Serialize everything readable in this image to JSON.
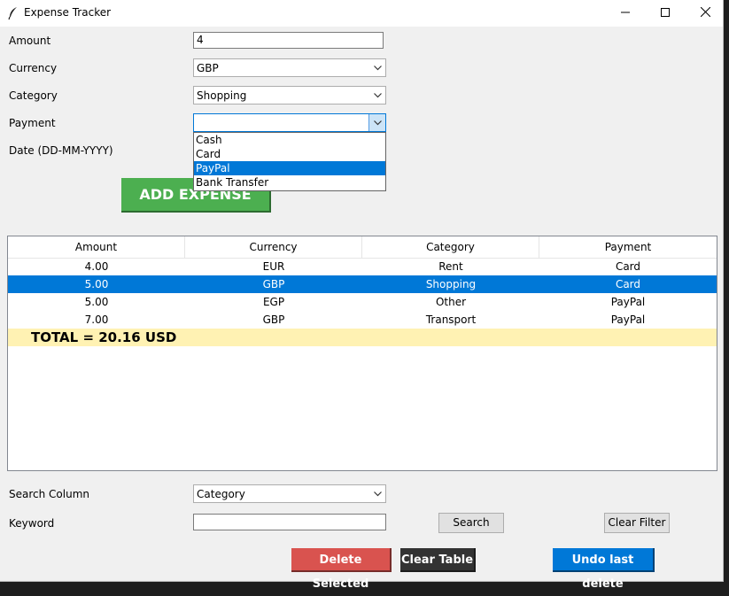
{
  "window": {
    "title": "Expense Tracker"
  },
  "form": {
    "amount_label": "Amount",
    "amount_value": "4",
    "currency_label": "Currency",
    "currency_value": "GBP",
    "category_label": "Category",
    "category_value": "Shopping",
    "payment_label": "Payment",
    "payment_value": "",
    "date_label": "Date (DD-MM-YYYY)",
    "payment_options": [
      "Cash",
      "Card",
      "PayPal",
      "Bank Transfer"
    ],
    "payment_highlighted": "PayPal",
    "add_button": "ADD EXPENSE"
  },
  "table": {
    "columns": [
      "Amount",
      "Currency",
      "Category",
      "Payment"
    ],
    "rows": [
      [
        "4.00",
        "EUR",
        "Rent",
        "Card"
      ],
      [
        "5.00",
        "GBP",
        "Shopping",
        "Card"
      ],
      [
        "5.00",
        "EGP",
        "Other",
        "PayPal"
      ],
      [
        "7.00",
        "GBP",
        "Transport",
        "PayPal"
      ]
    ],
    "selected_row": 1,
    "total": "TOTAL = 20.16 USD"
  },
  "search": {
    "column_label": "Search Column",
    "column_value": "Category",
    "keyword_label": "Keyword",
    "keyword_value": "",
    "search_button": "Search",
    "clear_filter_button": "Clear Filter"
  },
  "actions": {
    "delete_selected": "Delete Selected",
    "clear_table": "Clear Table",
    "undo_last_delete": "Undo last delete"
  },
  "colors": {
    "add": "#4caf50",
    "delete": "#d9534f",
    "clear": "#333333",
    "undo": "#0078d7",
    "total_bg": "#fff2b3",
    "selection": "#0078d7"
  }
}
